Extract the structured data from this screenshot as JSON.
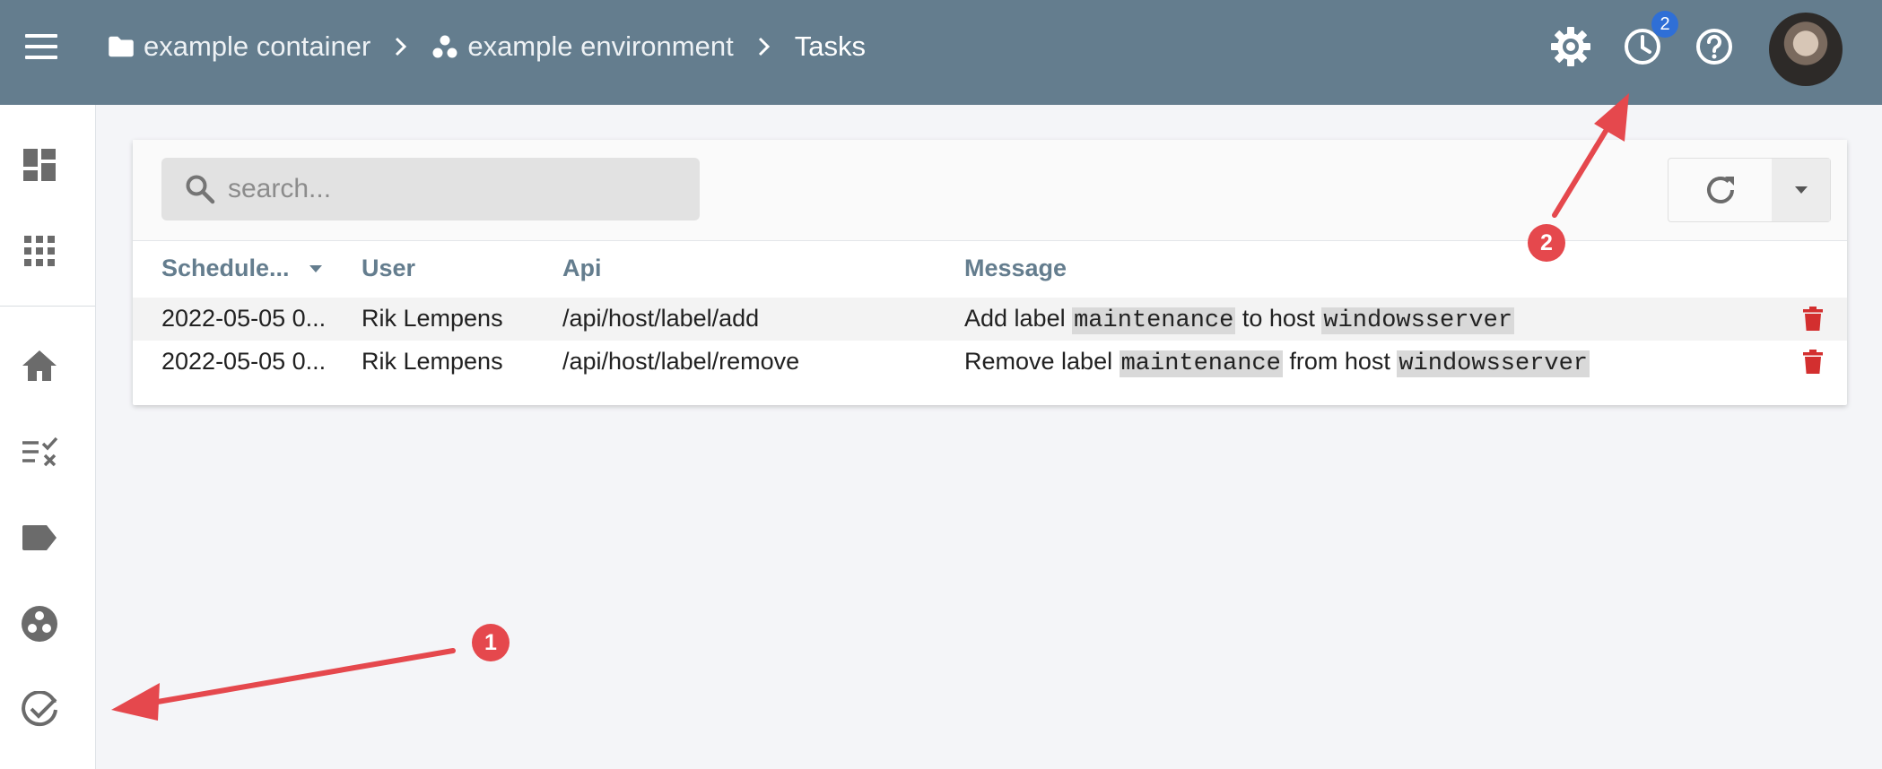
{
  "header": {
    "breadcrumb": [
      {
        "label": "example container",
        "icon": "folder-icon"
      },
      {
        "label": "example environment",
        "icon": "environment-icon"
      },
      {
        "label": "Tasks"
      }
    ],
    "tasks_badge_count": "2",
    "icons": [
      "menu-icon",
      "settings-gear-icon",
      "clock-icon",
      "help-icon",
      "avatar"
    ]
  },
  "sidebar": {
    "items": [
      {
        "icon": "dashboard-icon"
      },
      {
        "icon": "apps-grid-icon"
      },
      {
        "icon": "home-icon"
      },
      {
        "icon": "checklist-icon"
      },
      {
        "icon": "label-icon"
      },
      {
        "icon": "environment-circle-icon"
      },
      {
        "icon": "tasks-check-icon"
      }
    ]
  },
  "search": {
    "placeholder": "search..."
  },
  "table": {
    "columns": [
      "Schedule...",
      "User",
      "Api",
      "Message"
    ],
    "rows": [
      {
        "scheduled": "2022-05-05 0...",
        "user": "Rik Lempens",
        "api": "/api/host/label/add",
        "message": {
          "pre": "Add label ",
          "code1": "maintenance",
          "mid": " to host ",
          "code2": "windowsserver"
        }
      },
      {
        "scheduled": "2022-05-05 0...",
        "user": "Rik Lempens",
        "api": "/api/host/label/remove",
        "message": {
          "pre": "Remove label ",
          "code1": "maintenance",
          "mid": " from host ",
          "code2": "windowsserver"
        }
      }
    ]
  },
  "annotations": {
    "marker1": "1",
    "marker2": "2"
  },
  "colors": {
    "topbar": "#647d8e",
    "accent": "#2f6fd6",
    "delete": "#d32f2f",
    "annotation": "#e5484d"
  }
}
